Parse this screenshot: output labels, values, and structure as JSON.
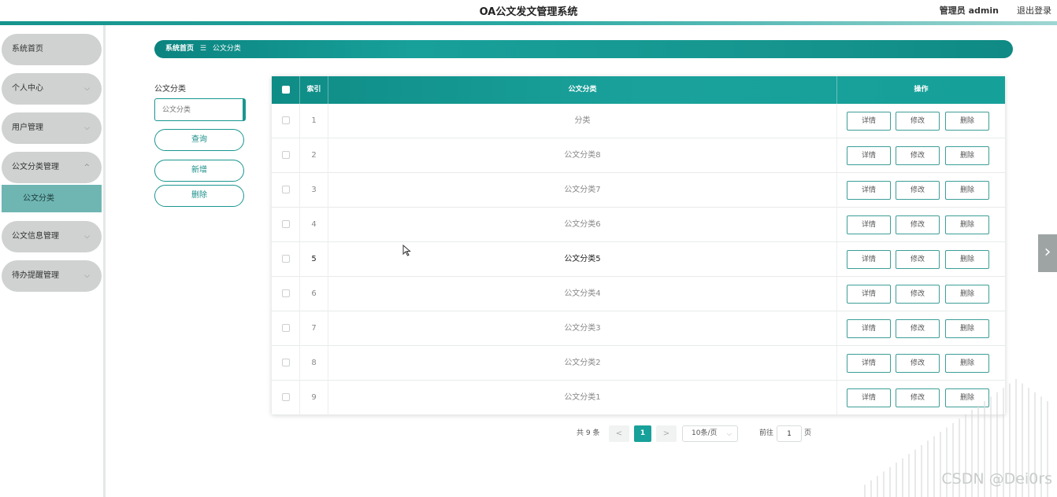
{
  "header": {
    "title": "OA公文发文管理系统",
    "user": "管理员 admin",
    "logout": "退出登录"
  },
  "sidebar": {
    "items": [
      {
        "label": "系统首页",
        "icon": ""
      },
      {
        "label": "个人中心",
        "icon": "chevron-down-icon"
      },
      {
        "label": "用户管理",
        "icon": "chevron-down-icon"
      },
      {
        "label": "公文分类管理",
        "icon": "chevron-up-icon"
      },
      {
        "label": "公文信息管理",
        "icon": "chevron-down-icon"
      },
      {
        "label": "待办提醒管理",
        "icon": "chevron-down-icon"
      }
    ],
    "active_sub": "公文分类"
  },
  "breadcrumb": {
    "home": "系统首页",
    "separator_icon": "menu-icon",
    "current": "公文分类"
  },
  "search": {
    "label": "公文分类",
    "placeholder": "公文分类",
    "query_button": "查询",
    "add_button": "新增",
    "delete_button": "删除"
  },
  "table": {
    "columns": [
      "索引",
      "公文分类",
      "操作"
    ],
    "rows": [
      {
        "index": "1",
        "category": "分类"
      },
      {
        "index": "2",
        "category": "公文分类8"
      },
      {
        "index": "3",
        "category": "公文分类7"
      },
      {
        "index": "4",
        "category": "公文分类6"
      },
      {
        "index": "5",
        "category": "公文分类5"
      },
      {
        "index": "6",
        "category": "公文分类4"
      },
      {
        "index": "7",
        "category": "公文分类3"
      },
      {
        "index": "8",
        "category": "公文分类2"
      },
      {
        "index": "9",
        "category": "公文分类1"
      }
    ],
    "actions": [
      "详情",
      "修改",
      "删除"
    ],
    "highlighted_index": "5"
  },
  "pagination": {
    "total": "共 9 条",
    "prev": "<",
    "current_page": "1",
    "next": ">",
    "page_size": "10条/页",
    "goto_label": "前往",
    "goto_value": "1",
    "page_suffix": "页"
  },
  "watermark": "CSDN @Dei0rs",
  "colors": {
    "primary": "#1aa19b",
    "sidebar_item": "#cfd2d1",
    "sidebar_active": "#6fb6b3"
  }
}
